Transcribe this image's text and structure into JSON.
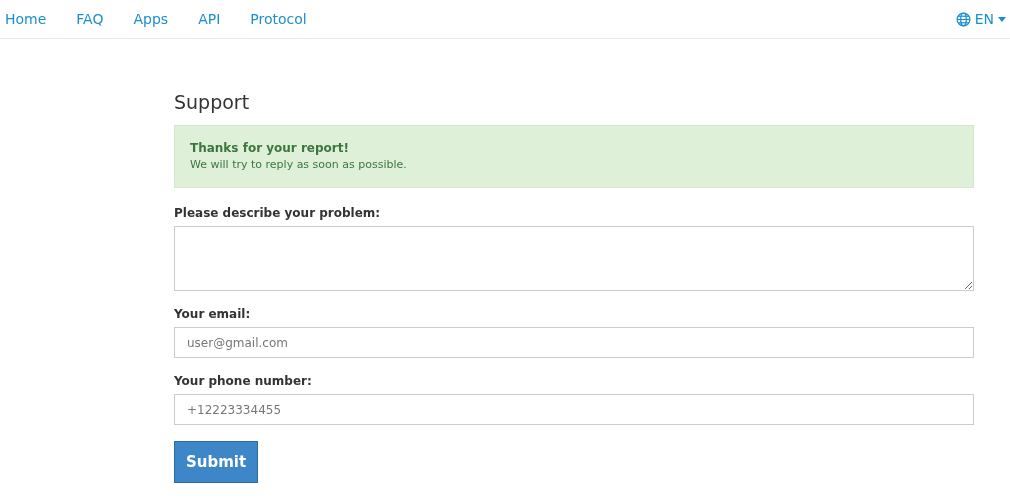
{
  "nav": {
    "links": [
      "Home",
      "FAQ",
      "Apps",
      "API",
      "Protocol"
    ],
    "language": "EN"
  },
  "page": {
    "title": "Support",
    "alert": {
      "title": "Thanks for your report!",
      "message": "We will try to reply as soon as possible."
    },
    "fields": [
      {
        "kind": "textarea",
        "label": "Please describe your problem:"
      },
      {
        "kind": "input",
        "label": "Your email:",
        "placeholder": "user@gmail.com"
      },
      {
        "kind": "input",
        "label": "Your phone number:",
        "placeholder": "+12223334455"
      }
    ],
    "submit": "Submit"
  }
}
